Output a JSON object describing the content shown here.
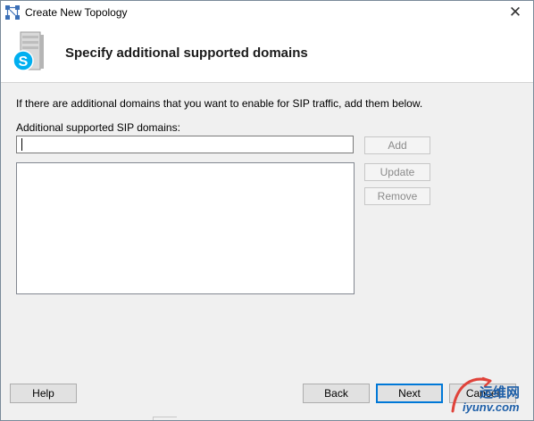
{
  "window": {
    "title": "Create New Topology",
    "close_glyph": "✕",
    "app_icon": "topology-builder-icon"
  },
  "header": {
    "icon": "skype-server-icon",
    "title": "Specify additional supported domains"
  },
  "form": {
    "instructions": "If there are additional domains that you want to enable for SIP traffic, add them below.",
    "domain_label": "Additional supported SIP domains:",
    "domain_value": "",
    "domains_list": []
  },
  "side_buttons": {
    "add": "Add",
    "update": "Update",
    "remove": "Remove"
  },
  "footer": {
    "help": "Help",
    "back": "Back",
    "next": "Next",
    "cancel": "Cancel"
  },
  "watermark": {
    "cn_text": "运维网",
    "en_text": "iyunv.com"
  },
  "colors": {
    "accent": "#0078d7",
    "skype_blue": "#00aff0",
    "watermark_blue": "#1e5fa8"
  }
}
